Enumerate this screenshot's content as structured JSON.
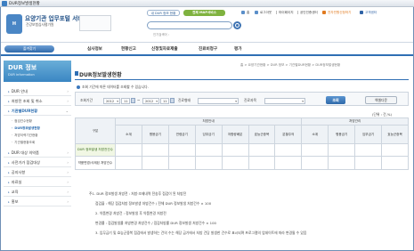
{
  "window": {
    "title": "DUR정보발생현황"
  },
  "header": {
    "logo_text": "H",
    "title": "요양기관 업무포털 서비스",
    "subtitle": "건강보험심사평가원",
    "btn_dur": "내 DUR 정보 현황",
    "btn_sitemap": "전체 MAP서비스",
    "search_placeholder": "",
    "popular_label": "인기검색어 : ",
    "util_links": [
      "홈",
      "로그아웃",
      "마이페이지",
      "공인인증센터",
      "전자민원신청하기",
      "고객센터"
    ]
  },
  "nav": {
    "favorites_label": "즐겨찾기",
    "items": [
      "심사정보",
      "현황신고",
      "신청및자료제출",
      "진료비청구",
      "평가"
    ]
  },
  "sidebar": {
    "head_title": "DUR 정보",
    "head_sub": "DUR information",
    "items": [
      {
        "label": "DUR 안내",
        "active": false
      },
      {
        "label": "처방전 조회 및 취소",
        "active": false
      },
      {
        "label": "기관별DUR현황",
        "active": true
      },
      {
        "label": "DUR 대상 의약품",
        "active": false
      },
      {
        "label": "사전가가 점검대상",
        "active": false
      },
      {
        "label": "공지사항",
        "active": false
      },
      {
        "label": "자료실",
        "active": false
      },
      {
        "label": "교육",
        "active": false
      },
      {
        "label": "홍보",
        "active": false
      }
    ],
    "subitems": [
      {
        "label": "점검건수현황",
        "active": false
      },
      {
        "label": "DUR정보발생현황",
        "active": true
      },
      {
        "label": "처방이력기관현황",
        "active": false
      },
      {
        "label": "기관별현황조회",
        "active": false
      }
    ]
  },
  "content": {
    "breadcrumb": "홈 > 요양기관현황 > DUR 정보 > 기관별DUR현황 > DUR정보발생현황",
    "title": "DUR정보발생현황",
    "notice": "조회 기간에 따른 데이터를 조회할 수 있습니다.",
    "filter": {
      "period_label": "조회기간",
      "from_year": "2012",
      "from_month": "11",
      "to_year": "2012",
      "to_month": "11",
      "tilde": "~",
      "type_label": "진료형태",
      "type_value": "",
      "kind_label": "진료과목",
      "kind_value": "",
      "query_button": "조회",
      "excel_button": "엑셀다운"
    },
    "unit": "(단위 : 건,%)",
    "table": {
      "col_group": "구분",
      "group_labels": [
        "처방안내",
        "처방관리"
      ],
      "sub_headers": [
        "소계",
        "병용금기",
        "연령금기",
        "임부금기",
        "저함량배분",
        "효능군중복",
        "분할주의",
        "소계",
        "병용금기",
        "임부금기",
        "효능군중복"
      ],
      "rows": [
        {
          "label": "DUR 정보발생 처방전건수",
          "cells": [
            "",
            "",
            "",
            "",
            "",
            "",
            "",
            "",
            "",
            "",
            ""
          ]
        },
        {
          "label": "약품변경/삭제된 처방건수",
          "cells": [
            "",
            "",
            "",
            "",
            "",
            "",
            "",
            "",
            "",
            "",
            ""
          ]
        }
      ]
    },
    "notes": [
      "주1. DUR 정보발생 처방전 : 처방·조제내역 전송후 점검이 된 처방전",
      "점검율 : 해당 점검처방 정보발생 처방건수 / 전체 DUR 정보발생 처방건수 × 100",
      "2. 약품변경 처방건 : 정보발생 후 약품변경 처방전",
      "변경률 : 점검발생률 처방변경 처방건수 / 점검처방률 DUR 정보발생 처방건수 × 100",
      "3. 입무금기 및 효능군중복 점검에서 발생하는 건의 수는 해당 금기에서 처방 건당 발생한 건수로 표시되며 프로그램의 업데이트에 따라 변경될 수 있음"
    ]
  }
}
